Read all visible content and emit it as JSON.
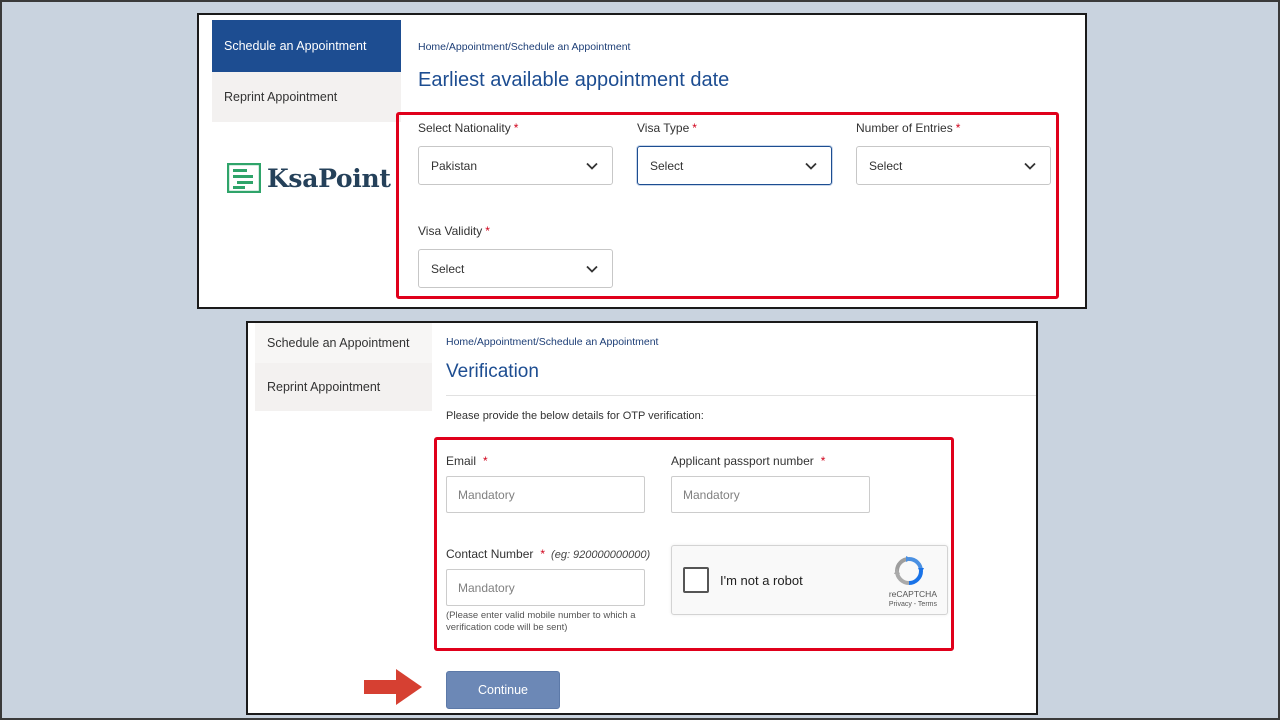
{
  "colors": {
    "background": "#c9d3df",
    "primary": "#1d4d91",
    "highlight": "#e0001b",
    "button": "#6c88b6",
    "arrow": "#d64032",
    "logo_green": "#2fa46a",
    "logo_dark": "#25415a"
  },
  "top_panel": {
    "sidebar": {
      "items": [
        {
          "label": "Schedule an Appointment",
          "active": true
        },
        {
          "label": "Reprint Appointment",
          "active": false
        }
      ],
      "logo_text": "KsaPoint",
      "logo_icon": "ksapoint-logo-icon"
    },
    "breadcrumb": "Home/Appointment/Schedule an Appointment",
    "title": "Earliest available appointment date",
    "fields": {
      "nationality": {
        "label": "Select Nationality",
        "required_mark": "*",
        "value": "Pakistan"
      },
      "visa_type": {
        "label": "Visa Type",
        "required_mark": "*",
        "value": "Select"
      },
      "entries": {
        "label": "Number of Entries",
        "required_mark": "*",
        "value": "Select"
      },
      "validity": {
        "label": "Visa Validity",
        "required_mark": "*",
        "value": "Select"
      }
    }
  },
  "bottom_panel": {
    "sidebar": {
      "items": [
        {
          "label": "Schedule an Appointment",
          "active": false
        },
        {
          "label": "Reprint Appointment",
          "active": false
        }
      ]
    },
    "breadcrumb": "Home/Appointment/Schedule an Appointment",
    "title": "Verification",
    "instruction": "Please provide the below details for OTP verification:",
    "fields": {
      "email": {
        "label": "Email",
        "required_mark": "*",
        "placeholder": "Mandatory"
      },
      "passport": {
        "label": "Applicant passport number",
        "required_mark": "*",
        "placeholder": "Mandatory"
      },
      "contact": {
        "label": "Contact Number",
        "required_mark": "*",
        "hint": "(eg: 920000000000)",
        "placeholder": "Mandatory",
        "note": "(Please enter valid mobile number to which a verification code will be sent)"
      }
    },
    "recaptcha": {
      "label": "I'm not a robot",
      "brand": "reCAPTCHA",
      "links": "Privacy - Terms"
    },
    "continue_label": "Continue"
  }
}
